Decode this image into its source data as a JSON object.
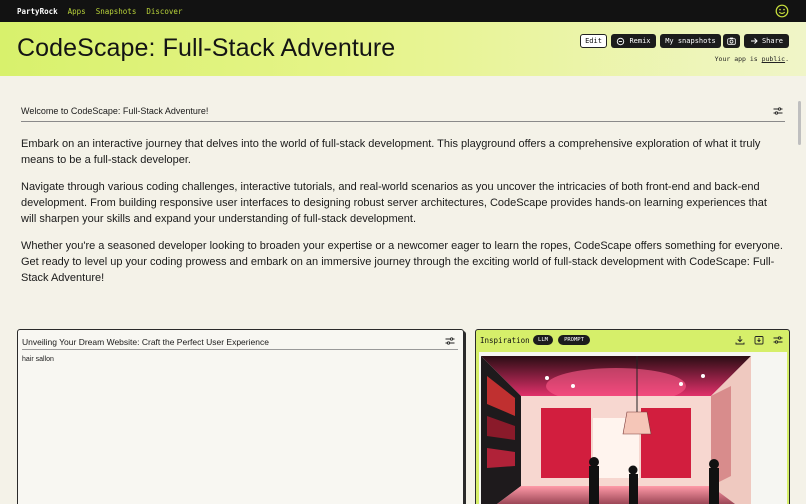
{
  "topnav": {
    "brand": "PartyRock",
    "links": [
      "Apps",
      "Snapshots",
      "Discover"
    ],
    "avatar_icon": "smiley-icon"
  },
  "hero": {
    "title": "CodeScape: Full-Stack Adventure",
    "buttons": {
      "edit": "Edit",
      "remix": "Remix",
      "snapshots": "My snapshots",
      "share": "Share"
    },
    "visibility_prefix": "Your app is",
    "visibility_value": "public",
    "visibility_suffix": "."
  },
  "welcome": {
    "title": "Welcome to CodeScape: Full-Stack Adventure!",
    "paragraphs": [
      "Embark on an interactive journey that delves into the world of full-stack development. This playground offers a comprehensive exploration of what it truly means to be a full-stack developer.",
      "Navigate through various coding challenges, interactive tutorials, and real-world scenarios as you uncover the intricacies of both front-end and back-end development. From building responsive user interfaces to designing robust server architectures, CodeScape provides hands-on learning experiences that will sharpen your skills and expand your understanding of full-stack development.",
      "Whether you're a seasoned developer looking to broaden your expertise or a newcomer eager to learn the ropes, CodeScape offers something for everyone. Get ready to level up your coding prowess and embark on an immersive journey through the exciting world of full-stack development with CodeScape: Full-Stack Adventure!"
    ]
  },
  "widgets": {
    "left": {
      "title": "Unveiling Your Dream Website: Craft the Perfect User Experience",
      "input_value": "hair sallon"
    },
    "right": {
      "title": "Inspiration",
      "badges": [
        "LLM",
        "PROMPT"
      ],
      "image_subject": "salon interior illustration"
    }
  },
  "colors": {
    "accent": "#d6ef6a",
    "nav_bg": "#121212",
    "nav_link": "#b8d23a",
    "page_bg": "#f4f2e8"
  }
}
